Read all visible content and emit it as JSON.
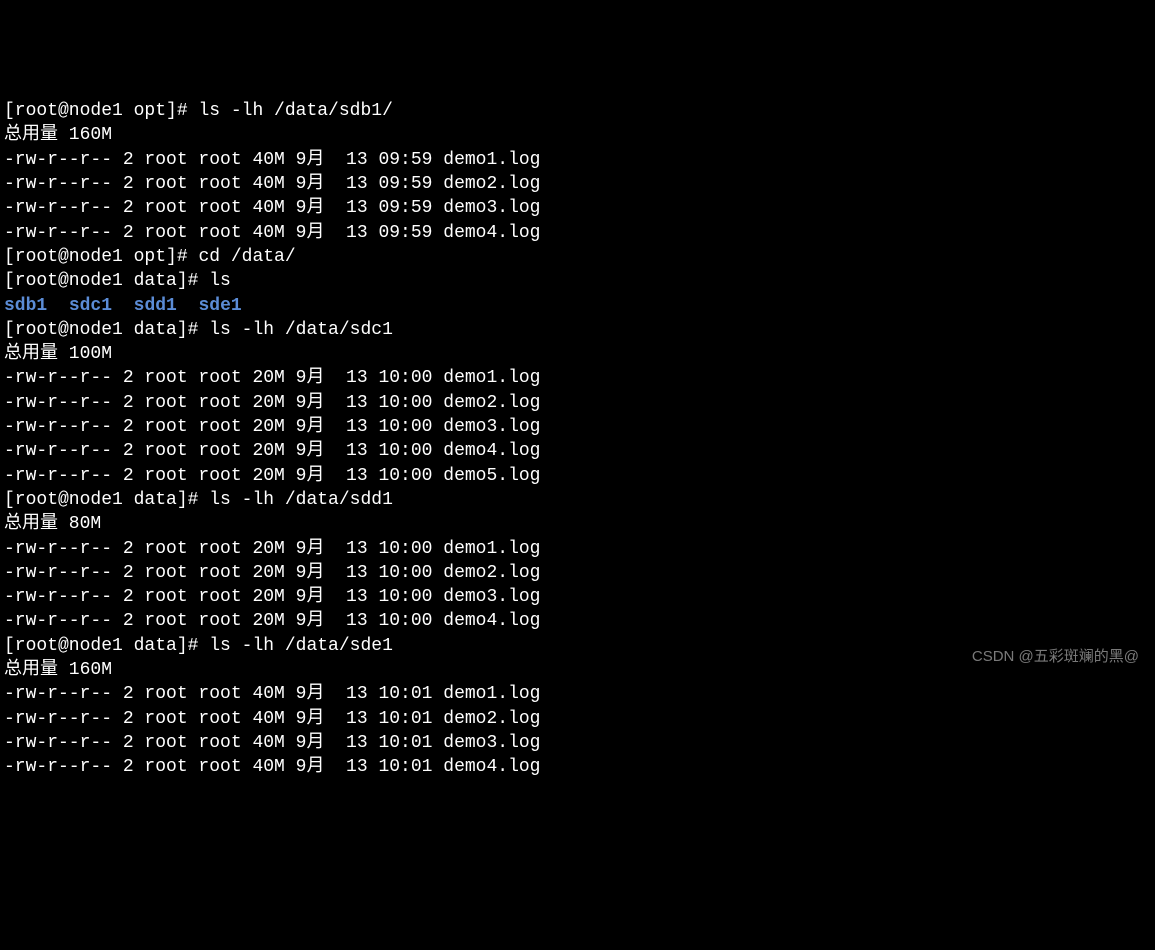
{
  "sections": [
    {
      "prompt": "[root@node1 opt]# ",
      "command": "ls -lh /data/sdb1/",
      "total": "总用量 160M",
      "files": [
        "-rw-r--r-- 2 root root 40M 9月  13 09:59 demo1.log",
        "-rw-r--r-- 2 root root 40M 9月  13 09:59 demo2.log",
        "-rw-r--r-- 2 root root 40M 9月  13 09:59 demo3.log",
        "-rw-r--r-- 2 root root 40M 9月  13 09:59 demo4.log"
      ]
    },
    {
      "prompt": "[root@node1 opt]# ",
      "command": "cd /data/",
      "total": null,
      "files": []
    },
    {
      "prompt": "[root@node1 data]# ",
      "command": "ls",
      "total": null,
      "dirs": [
        "sdb1",
        "sdc1",
        "sdd1",
        "sde1"
      ]
    },
    {
      "prompt": "[root@node1 data]# ",
      "command": "ls -lh /data/sdc1",
      "total": "总用量 100M",
      "files": [
        "-rw-r--r-- 2 root root 20M 9月  13 10:00 demo1.log",
        "-rw-r--r-- 2 root root 20M 9月  13 10:00 demo2.log",
        "-rw-r--r-- 2 root root 20M 9月  13 10:00 demo3.log",
        "-rw-r--r-- 2 root root 20M 9月  13 10:00 demo4.log",
        "-rw-r--r-- 2 root root 20M 9月  13 10:00 demo5.log"
      ]
    },
    {
      "prompt": "[root@node1 data]# ",
      "command": "ls -lh /data/sdd1",
      "total": "总用量 80M",
      "files": [
        "-rw-r--r-- 2 root root 20M 9月  13 10:00 demo1.log",
        "-rw-r--r-- 2 root root 20M 9月  13 10:00 demo2.log",
        "-rw-r--r-- 2 root root 20M 9月  13 10:00 demo3.log",
        "-rw-r--r-- 2 root root 20M 9月  13 10:00 demo4.log"
      ]
    },
    {
      "prompt": "[root@node1 data]# ",
      "command": "ls -lh /data/sde1",
      "total": "总用量 160M",
      "files": [
        "-rw-r--r-- 2 root root 40M 9月  13 10:01 demo1.log",
        "-rw-r--r-- 2 root root 40M 9月  13 10:01 demo2.log",
        "-rw-r--r-- 2 root root 40M 9月  13 10:01 demo3.log",
        "-rw-r--r-- 2 root root 40M 9月  13 10:01 demo4.log"
      ]
    }
  ],
  "watermark": "CSDN @五彩斑斓的黑@"
}
